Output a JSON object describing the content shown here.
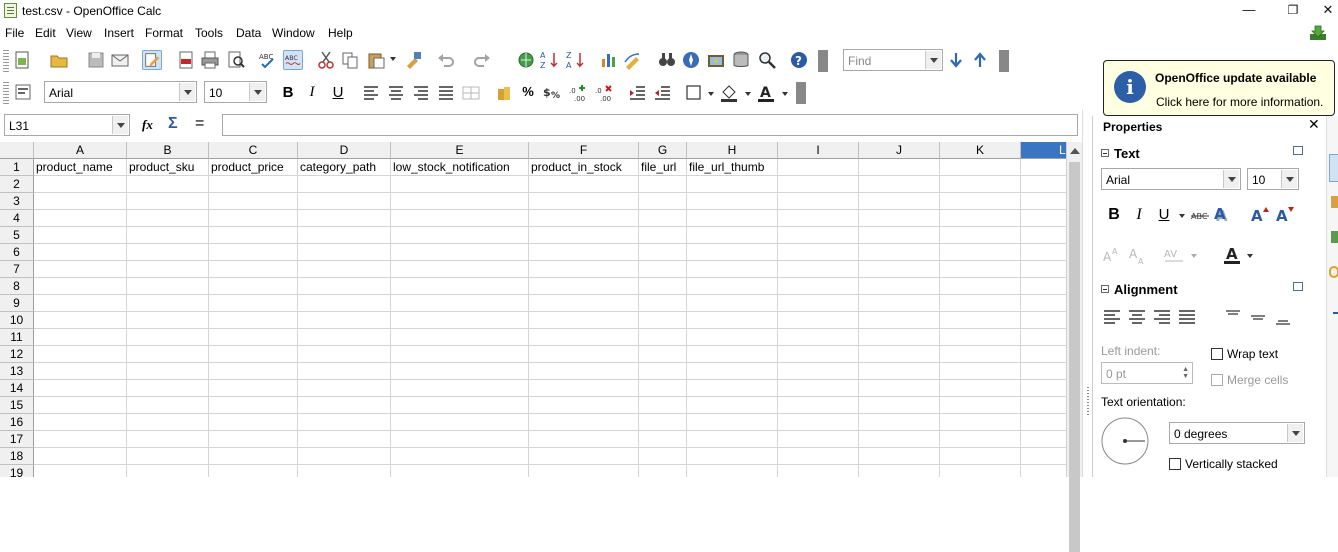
{
  "window": {
    "title": "test.csv - OpenOffice Calc",
    "minimize": "—",
    "restore": "❐",
    "close": "✕"
  },
  "menu": [
    "File",
    "Edit",
    "View",
    "Insert",
    "Format",
    "Tools",
    "Data",
    "Window",
    "Help"
  ],
  "toolbar": {
    "find_placeholder": "Find",
    "font_name": "Arial",
    "font_size": "10",
    "bold": "B",
    "italic": "I",
    "underline": "U",
    "percent": "%"
  },
  "formula_bar": {
    "name_box": "L31",
    "function_wizard": "fx",
    "sum": "Σ",
    "equals": "="
  },
  "sheet": {
    "columns": [
      "A",
      "B",
      "C",
      "D",
      "E",
      "F",
      "G",
      "H",
      "I",
      "J",
      "K",
      "L"
    ],
    "rows": [
      "1",
      "2",
      "3",
      "4",
      "5",
      "6",
      "7",
      "8",
      "9",
      "10",
      "11",
      "12",
      "13",
      "14",
      "15",
      "16",
      "17",
      "18",
      "19"
    ],
    "row1": [
      "product_name",
      "product_sku",
      "product_price",
      "category_path",
      "low_stock_notification",
      "product_in_stock",
      "file_url",
      "file_url_thumb",
      "",
      "",
      "",
      ""
    ],
    "selected_column": "L"
  },
  "notification": {
    "title": "OpenOffice update available",
    "body": "Click here for more information."
  },
  "properties": {
    "title": "Properties",
    "close": "✕",
    "text_section": "Text",
    "font_name": "Arial",
    "font_size": "10",
    "alignment_section": "Alignment",
    "left_indent_label": "Left indent:",
    "left_indent_value": "0 pt",
    "wrap_text": "Wrap text",
    "merge_cells": "Merge cells",
    "text_orientation_label": "Text orientation:",
    "orientation_value": "0 degrees",
    "vertically_stacked": "Vertically stacked"
  },
  "colors": {
    "selected_header": "#3a75c4",
    "info_icon": "#2d5fa8",
    "notification_bg": "#ffffe1"
  }
}
